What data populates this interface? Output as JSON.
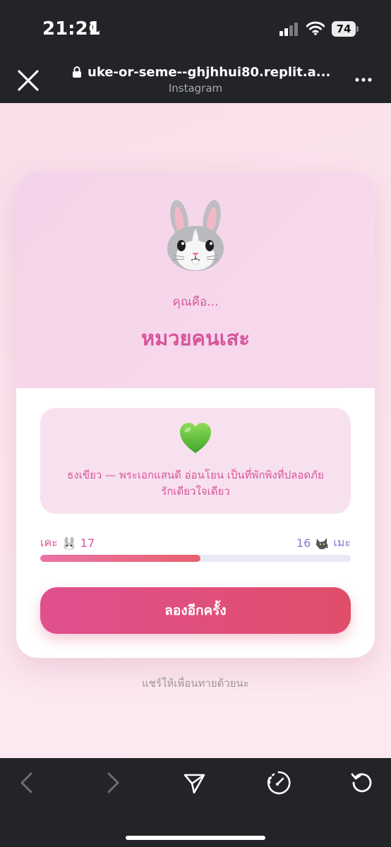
{
  "status_bar": {
    "time": "21:21",
    "battery": "74",
    "icons": [
      "moon-icon",
      "signal-icon",
      "wifi-icon",
      "battery-icon"
    ]
  },
  "browser": {
    "url": "uke-or-seme--ghjhhui80.replit.a...",
    "subtitle": "Instagram",
    "icons": [
      "close-icon",
      "lock-icon",
      "more-icon"
    ]
  },
  "result": {
    "you_are": "คุณคือ...",
    "title": "หมวยคนเสะ",
    "description_line1": "ธงเขียว — พระเอกแสนดี อ่อนโยน เป็นที่พักพิงที่ปลอดภัย",
    "description_line2": "รักเดียวใจเดียว",
    "icons": [
      "rabbit-icon",
      "green-heart-icon"
    ]
  },
  "score": {
    "uke_label": "เคะ",
    "uke_value": "17",
    "seme_value": "16",
    "seme_label": "เมะ",
    "uke_fraction": 0.515,
    "icons": [
      "rabbit-icon",
      "wolf-icon"
    ],
    "colors": {
      "uke": "#d6559a",
      "seme": "#8a74d4"
    }
  },
  "actions": {
    "retry_label": "ลองอีกครั้ง",
    "share_text": "แชร์ให้เพื่อนทายด้วยนะ"
  },
  "toolbar": {
    "icons": [
      "back-icon",
      "forward-icon",
      "share-icon",
      "compass-icon",
      "reload-icon"
    ]
  },
  "colors": {
    "accent": "#d6559a",
    "button_start": "#e0508f",
    "button_end": "#e14e6a",
    "chrome": "#222428"
  }
}
